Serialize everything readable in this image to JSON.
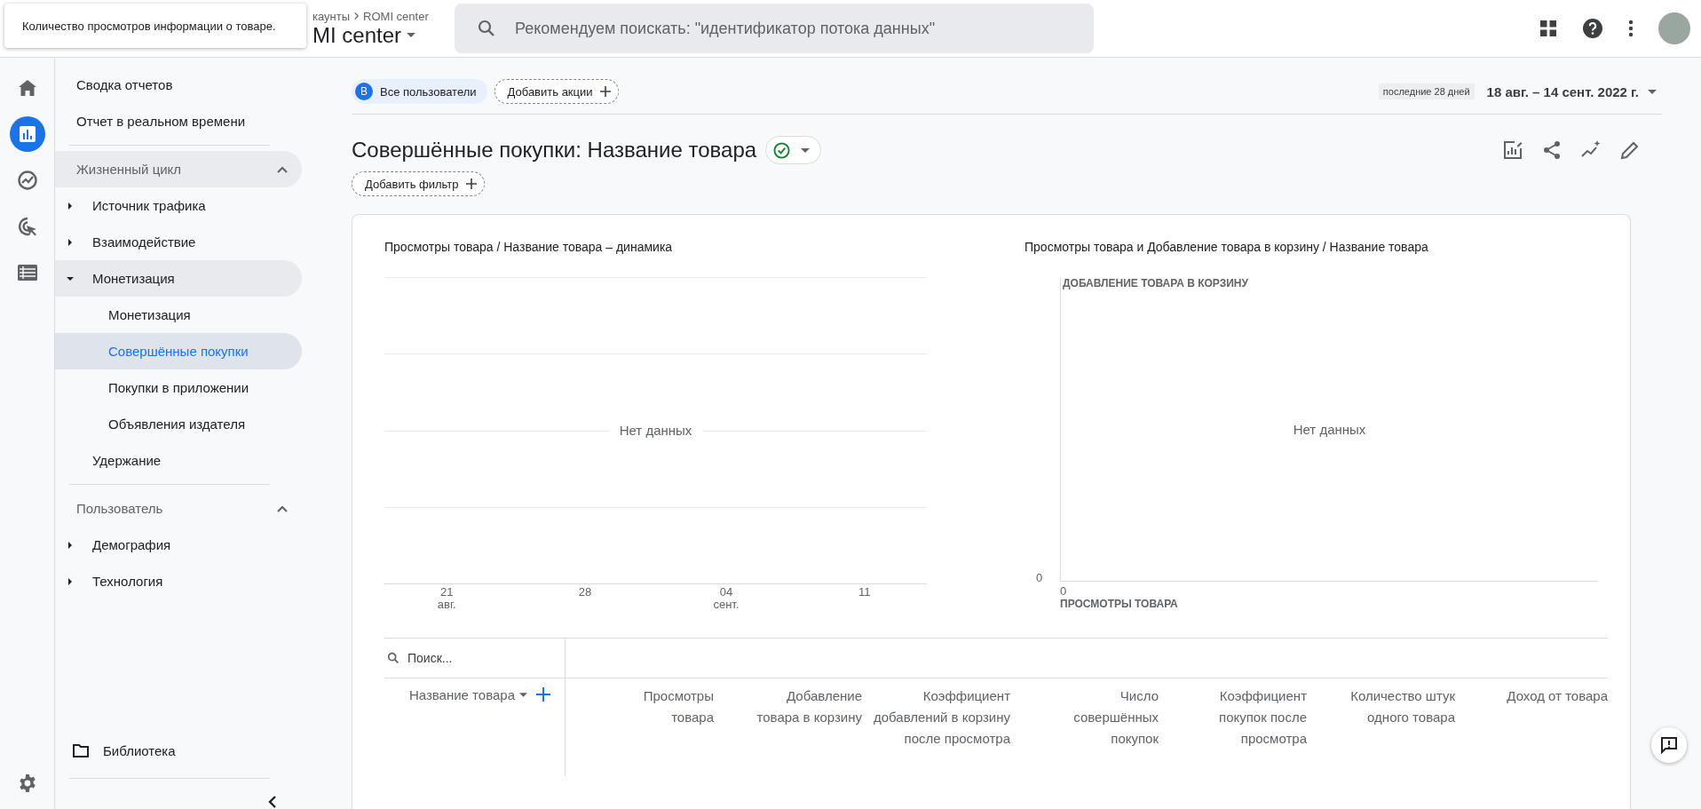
{
  "tooltip": "Количество просмотров информации о товаре.",
  "header": {
    "breadcrumb": [
      "каунты",
      "ROMI center"
    ],
    "property": "MI center",
    "search": {
      "placeholder": "Рекомендуем поискать: \"идентификатор потока данных\""
    }
  },
  "rail": [
    {
      "kind": "home",
      "selected": false
    },
    {
      "kind": "reports",
      "selected": true
    },
    {
      "kind": "explore",
      "selected": false
    },
    {
      "kind": "advertising",
      "selected": false
    },
    {
      "kind": "configure",
      "selected": false
    }
  ],
  "nav": {
    "top": [
      {
        "label": "Сводка отчетов",
        "selected": false
      },
      {
        "label": "Отчет в реальном времени",
        "selected": false
      }
    ],
    "sections": [
      {
        "title": "Жизненный цикл",
        "expanded": true,
        "hovered": true,
        "items": [
          {
            "label": "Источник трафика",
            "expanded": false,
            "selected": false
          },
          {
            "label": "Взаимодействие",
            "expanded": false,
            "selected": false
          },
          {
            "label": "Монетизация",
            "expanded": true,
            "selected": false,
            "children": [
              {
                "label": "Монетизация",
                "selected": false
              },
              {
                "label": "Совершённые покупки",
                "selected": true
              },
              {
                "label": "Покупки в приложении",
                "selected": false
              },
              {
                "label": "Объявления издателя",
                "selected": false
              }
            ]
          },
          {
            "label": "Удержание",
            "selected": false
          }
        ]
      },
      {
        "title": "Пользователь",
        "expanded": true,
        "hovered": false,
        "items": [
          {
            "label": "Демография",
            "expanded": false,
            "selected": false
          },
          {
            "label": "Технология",
            "expanded": false,
            "selected": false
          }
        ]
      }
    ],
    "library": "Библиотека"
  },
  "segment": {
    "badge": "B",
    "label": "Все пользователи"
  },
  "add_comparison": "Добавить акции",
  "date_range": {
    "caption": "последние 28 дней",
    "value": "18 авг. – 14 сент. 2022 г."
  },
  "report": {
    "title": "Совершённые покупки: Название товара",
    "add_filter": "Добавить фильтр"
  },
  "charts": [
    {
      "title": "Просмотры товара / Название товара – динамика",
      "no_data": "Нет данных",
      "x_labels": [
        {
          "day": "21",
          "month": "авг."
        },
        {
          "day": "28"
        },
        {
          "day": "04",
          "month": "сент."
        },
        {
          "day": "11"
        }
      ]
    },
    {
      "title": "Просмотры товара и Добавление товара в корзину / Название товара",
      "no_data": "Нет данных",
      "y_axis_title": "ДОБАВЛЕНИЕ ТОВАРА В КОРЗИНУ",
      "x_axis_title": "ПРОСМОТРЫ ТОВАРА",
      "y_zero": "0",
      "x_zero": "0"
    }
  ],
  "table": {
    "search": {
      "placeholder": "Поиск..."
    },
    "dimension": "Название товара",
    "columns": [
      "Просмотры товара",
      "Добавление товара в корзину",
      "Коэффициент добавлений в корзину после просмотра",
      "Число совершённых покупок",
      "Коэффициент покупок после просмотра",
      "Количество штук одного товара",
      "Доход от товара"
    ]
  }
}
